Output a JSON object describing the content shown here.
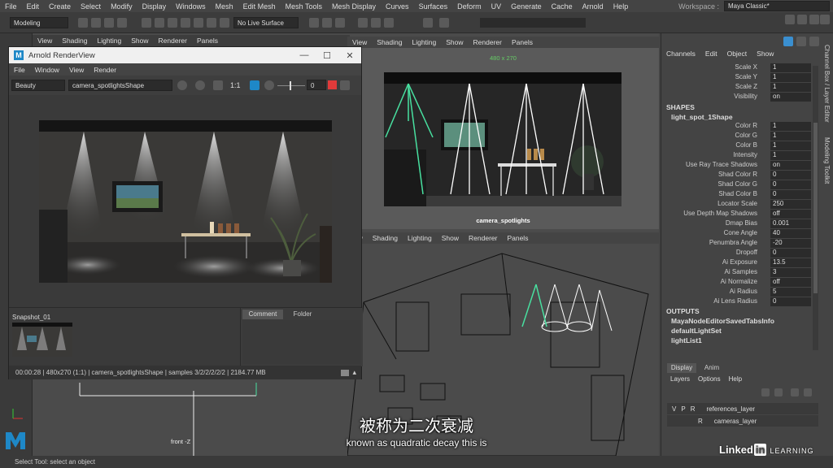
{
  "menubar": {
    "items": [
      "File",
      "Edit",
      "Create",
      "Select",
      "Modify",
      "Display",
      "Windows",
      "Mesh",
      "Edit Mesh",
      "Mesh Tools",
      "Mesh Display",
      "Curves",
      "Surfaces",
      "Deform",
      "UV",
      "Generate",
      "Cache",
      "Arnold",
      "Help"
    ],
    "workspace_label": "Workspace :",
    "workspace_value": "Maya Classic*"
  },
  "shelf": {
    "mode": "Modeling",
    "live_surface": "No Live Surface"
  },
  "render_view": {
    "title": "Arnold RenderView",
    "menu": [
      "File",
      "Window",
      "View",
      "Render"
    ],
    "aov": "Beauty",
    "camera": "camera_spotlightsShape",
    "ratio": "1:1",
    "exposure": "0",
    "snapshot_label": "Snapshot_01",
    "tabs": [
      "Comment",
      "Folder"
    ],
    "status": "00:00:28 | 480x270 (1:1) | camera_spotlightsShape  | samples 3/2/2/2/2/2 | 2184.77 MB"
  },
  "behind_viewport_menu": [
    "View",
    "Shading",
    "Lighting",
    "Show",
    "Renderer",
    "Panels"
  ],
  "top_viewport": {
    "menu": [
      "View",
      "Shading",
      "Lighting",
      "Show",
      "Renderer",
      "Panels"
    ],
    "resolution": "480 x 270",
    "camera_label": "camera_spotlights"
  },
  "bottom_viewport": {
    "menu": [
      "iew",
      "Shading",
      "Lighting",
      "Show",
      "Renderer",
      "Panels"
    ]
  },
  "front_label": "front -Z",
  "channel_box": {
    "menu": [
      "Channels",
      "Edit",
      "Object",
      "Show"
    ],
    "transform": [
      {
        "label": "Scale X",
        "value": "1"
      },
      {
        "label": "Scale Y",
        "value": "1"
      },
      {
        "label": "Scale Z",
        "value": "1"
      },
      {
        "label": "Visibility",
        "value": "on"
      }
    ],
    "shapes_header": "SHAPES",
    "shape_name": "light_spot_1Shape",
    "shape_attrs": [
      {
        "label": "Color R",
        "value": "1"
      },
      {
        "label": "Color G",
        "value": "1"
      },
      {
        "label": "Color B",
        "value": "1"
      },
      {
        "label": "Intensity",
        "value": "1"
      },
      {
        "label": "Use Ray Trace Shadows",
        "value": "on"
      },
      {
        "label": "Shad Color R",
        "value": "0"
      },
      {
        "label": "Shad Color G",
        "value": "0"
      },
      {
        "label": "Shad Color B",
        "value": "0"
      },
      {
        "label": "Locator Scale",
        "value": "250"
      },
      {
        "label": "Use Depth Map Shadows",
        "value": "off"
      },
      {
        "label": "Dmap Bias",
        "value": "0.001"
      },
      {
        "label": "Cone Angle",
        "value": "40"
      },
      {
        "label": "Penumbra Angle",
        "value": "-20"
      },
      {
        "label": "Dropoff",
        "value": "0"
      },
      {
        "label": "Ai Exposure",
        "value": "13.5"
      },
      {
        "label": "Ai Samples",
        "value": "3"
      },
      {
        "label": "Ai Normalize",
        "value": "off"
      },
      {
        "label": "Ai Radius",
        "value": "5"
      },
      {
        "label": "Ai Lens Radius",
        "value": "0"
      }
    ],
    "outputs_header": "OUTPUTS",
    "outputs": [
      "MayaNodeEditorSavedTabsInfo",
      "defaultLightSet",
      "lightList1"
    ],
    "side_tabs": [
      "Channel Box / Layer Editor",
      "Modeling Toolkit"
    ]
  },
  "layer_editor": {
    "tabs": [
      "Display",
      "Anim"
    ],
    "menu": [
      "Layers",
      "Options",
      "Help"
    ],
    "layers": [
      {
        "v": "V",
        "p": "P",
        "r": "R",
        "name": "references_layer"
      },
      {
        "v": "",
        "p": "",
        "r": "R",
        "name": "cameras_layer"
      }
    ]
  },
  "status_line": "Select Tool: select an object",
  "subtitles": {
    "chinese": "被称为二次衰减",
    "english": "known as quadratic decay this is"
  },
  "watermark": {
    "brand": "Linked",
    "in": "in",
    "suffix": "LEARNING"
  },
  "colors": {
    "maya_blue": "#1e88c7",
    "panel_bg": "#444444",
    "field_bg": "#2b2b2b",
    "selected_light": "#48e0a0"
  }
}
